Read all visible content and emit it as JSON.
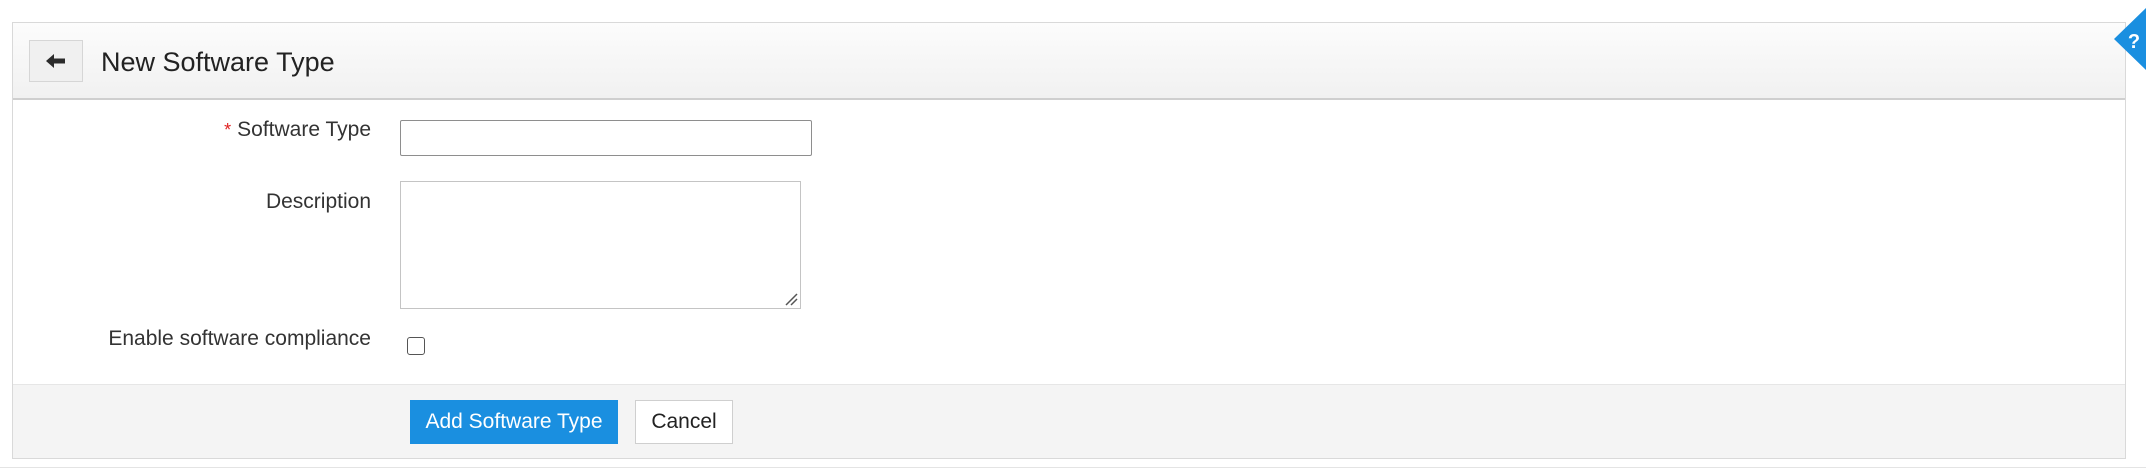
{
  "header": {
    "title": "New Software Type",
    "back_icon": "arrow-left-icon"
  },
  "form": {
    "software_type": {
      "label": "Software Type",
      "required_marker": "*",
      "value": ""
    },
    "description": {
      "label": "Description",
      "value": ""
    },
    "compliance": {
      "label": "Enable software compliance",
      "checked": false
    }
  },
  "actions": {
    "submit_label": "Add Software Type",
    "cancel_label": "Cancel"
  },
  "help": {
    "icon": "question-mark-icon",
    "glyph": "?"
  },
  "colors": {
    "accent": "#1a8fe0",
    "required": "#e02020"
  }
}
